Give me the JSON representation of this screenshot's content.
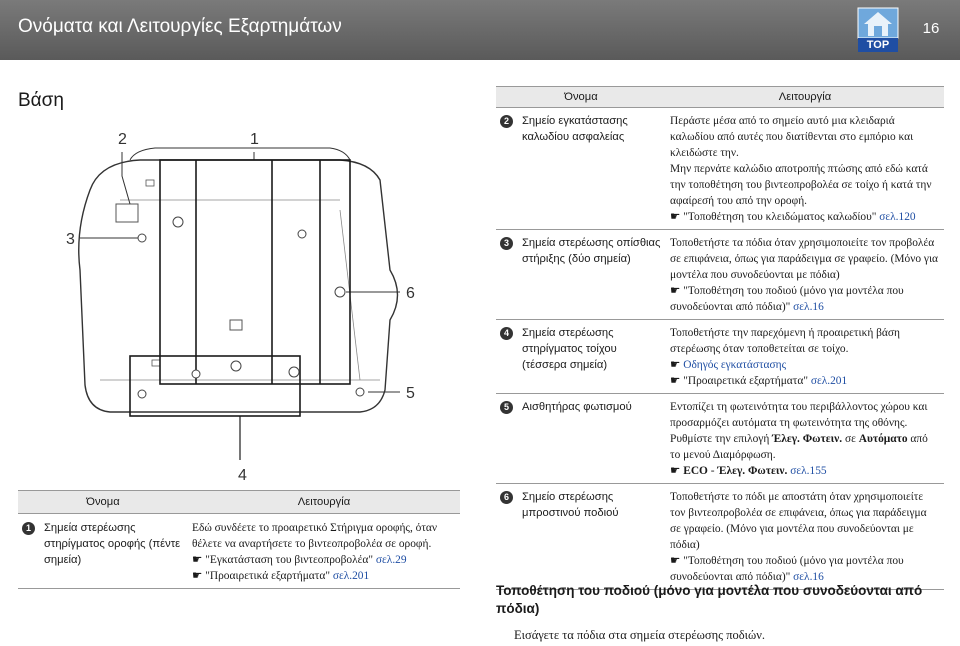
{
  "header": {
    "title": "Ονόματα και Λειτουργίες Εξαρτημάτων",
    "top_label": "TOP",
    "page_number": "16"
  },
  "section_title": "Βάση",
  "callouts": {
    "c1": "1",
    "c2": "2",
    "c3": "3",
    "c4": "4",
    "c5": "5",
    "c6": "6"
  },
  "left_table": {
    "col_name": "Όνομα",
    "col_function": "Λειτουργία",
    "row": {
      "badge": "1",
      "name": "Σημεία στερέωσης στηρίγματος οροφής (πέντε σημεία)",
      "func_text": "Εδώ συνδέετε το προαιρετικό Στήριγμα οροφής, όταν θέλετε να αναρτήσετε το βιντεοπροβολέα σε οροφή.",
      "ref1_text": "\"Εγκατάσταση του βιντεοπροβολέα\" ",
      "ref1_page": "σελ.29",
      "ref2_text": "\"Προαιρετικά εξαρτήματα\" ",
      "ref2_page": "σελ.201"
    }
  },
  "right_table": {
    "col_name": "Όνομα",
    "col_function": "Λειτουργία",
    "rows": [
      {
        "badge": "2",
        "name": "Σημείο εγκατάστασης καλωδίου ασφαλείας",
        "func_text": "Περάστε μέσα από το σημείο αυτό μια κλειδαριά καλωδίου από αυτές που διατίθενται στο εμπόριο και κλειδώστε την.",
        "func_text2": "Μην περνάτε καλώδιο αποτροπής πτώσης από εδώ κατά την τοποθέτηση του βιντεοπροβολέα σε τοίχο ή κατά την αφαίρεσή του από την οροφή.",
        "ref_text": "\"Τοποθέτηση του κλειδώματος καλωδίου\" ",
        "ref_page": "σελ.120"
      },
      {
        "badge": "3",
        "name": "Σημεία στερέωσης οπίσθιας στήριξης (δύο σημεία)",
        "func_text": "Τοποθετήστε τα πόδια όταν χρησιμοποιείτε τον προβολέα σε επιφάνεια, όπως για παράδειγμα σε γραφείο. (Μόνο για μοντέλα που συνοδεύονται με πόδια)",
        "ref_text": "\"Τοποθέτηση του ποδιού (μόνο για μοντέλα που συνοδεύονται από πόδια)\" ",
        "ref_page": "σελ.16"
      },
      {
        "badge": "4",
        "name": "Σημεία στερέωσης στηρίγματος τοίχου (τέσσερα σημεία)",
        "func_text": "Τοποθετήστε την παρεχόμενη ή προαιρετική βάση στερέωσης όταν τοποθετείται σε τοίχο.",
        "ref_link": "Οδηγός εγκατάστασης",
        "ref_text": "\"Προαιρετικά εξαρτήματα\" ",
        "ref_page": "σελ.201"
      },
      {
        "badge": "5",
        "name": "Αισθητήρας φωτισμού",
        "func_text": "Εντοπίζει τη φωτεινότητα του περιβάλλοντος χώρου και προσαρμόζει αυτόματα τη φωτεινότητα της οθόνης. Ρυθμίστε την επιλογή ",
        "func_bold1": "Έλεγ. Φωτειν.",
        "func_mid": " σε ",
        "func_bold2": "Αυτόματο",
        "func_end": " από το μενού Διαμόρφωση.",
        "ref_bold": "ECO",
        "ref_sep": " - ",
        "ref_bold2": "Έλεγ. Φωτειν.",
        "ref_page": " σελ.155"
      },
      {
        "badge": "6",
        "name": "Σημείο στερέωσης μπροστινού ποδιού",
        "func_text": "Τοποθετήστε το πόδι με αποστάτη όταν χρησιμοποιείτε τον βιντεοπροβολέα σε επιφάνεια, όπως για παράδειγμα σε γραφείο. (Μόνο για μοντέλα που συνοδεύονται με πόδια)",
        "ref_text": "\"Τοποθέτηση του ποδιού (μόνο για μοντέλα που συνοδεύονται από πόδια)\" ",
        "ref_page": "σελ.16"
      }
    ]
  },
  "sub_heading": "Τοποθέτηση του ποδιού (μόνο για μοντέλα που συνοδεύονται από πόδια)",
  "body_text": "Εισάγετε τα πόδια στα σημεία στερέωσης ποδιών."
}
